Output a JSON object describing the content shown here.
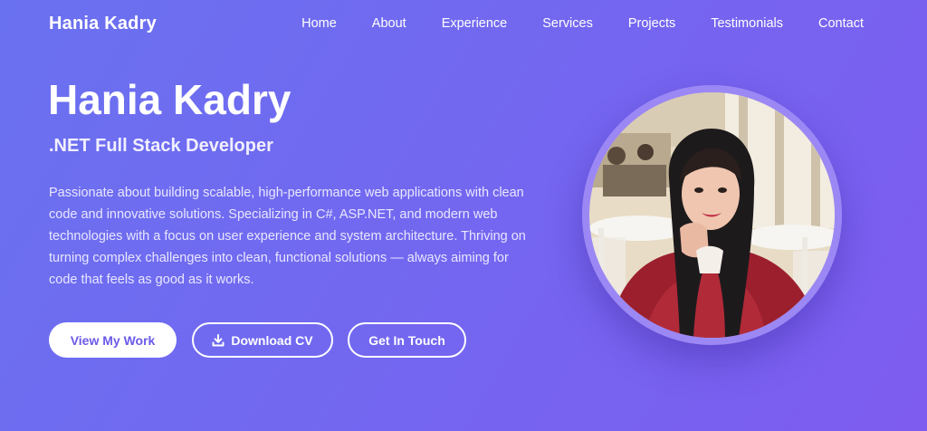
{
  "nav": {
    "brand": "Hania Kadry",
    "links": [
      "Home",
      "About",
      "Experience",
      "Services",
      "Projects",
      "Testimonials",
      "Contact"
    ]
  },
  "hero": {
    "title": "Hania Kadry",
    "subtitle": ".NET Full Stack Developer",
    "description": "Passionate about building scalable, high-performance web applications with clean code and innovative solutions. Specializing in C#, ASP.NET, and modern web technologies with a focus on user experience and system architecture. Thriving on turning complex challenges into clean, functional solutions — always aiming for code that feels as good as it works.",
    "buttons": {
      "view_work": "View My Work",
      "download_cv": "Download CV",
      "get_in_touch": "Get In Touch"
    }
  },
  "icons": {
    "download": "download-icon"
  },
  "colors": {
    "background_start": "#6a71f0",
    "background_end": "#7e5cf0",
    "accent_text": "#6b5ae8",
    "photo_ring": "#9b88f4"
  }
}
